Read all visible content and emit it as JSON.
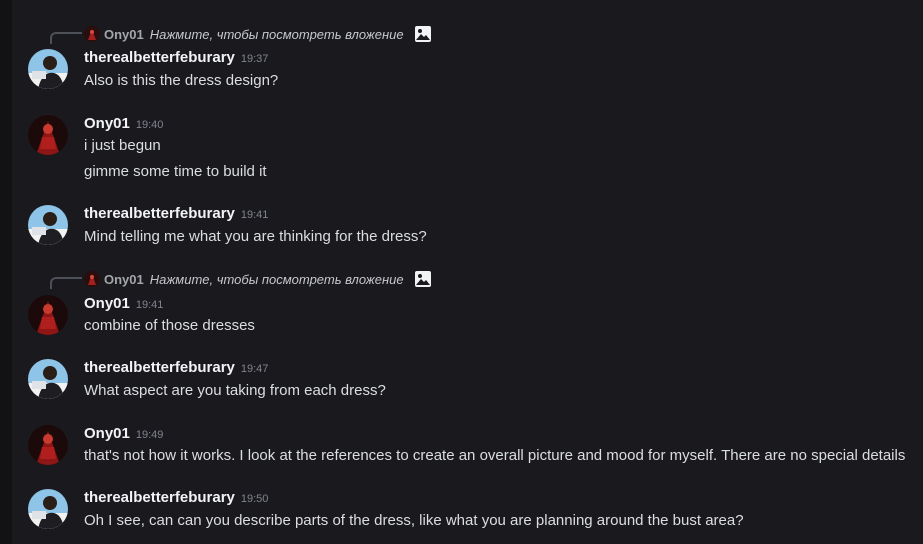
{
  "messages": [
    {
      "reply": {
        "author": "Ony01",
        "text": "Нажмите, чтобы посмотреть вложение"
      },
      "author": "therealbetterfeburary",
      "time": "19:37",
      "avatar": "blue-avatar-icon",
      "lines": [
        "Also is this the dress design?"
      ]
    },
    {
      "author": "Ony01",
      "time": "19:40",
      "avatar": "red-avatar-icon",
      "lines": [
        "i just begun",
        "gimme some time to build it"
      ]
    },
    {
      "author": "therealbetterfeburary",
      "time": "19:41",
      "avatar": "blue-avatar-icon",
      "lines": [
        "Mind telling me what you are thinking for the dress?"
      ]
    },
    {
      "reply": {
        "author": "Ony01",
        "text": "Нажмите, чтобы посмотреть вложение"
      },
      "author": "Ony01",
      "time": "19:41",
      "avatar": "red-avatar-icon",
      "lines": [
        "combine of those dresses"
      ]
    },
    {
      "author": "therealbetterfeburary",
      "time": "19:47",
      "avatar": "blue-avatar-icon",
      "lines": [
        "What aspect are you taking from each dress?"
      ]
    },
    {
      "author": "Ony01",
      "time": "19:49",
      "avatar": "red-avatar-icon",
      "lines": [
        "that's not how it works. I look at the references to create an overall picture and mood for myself. There are no special details"
      ]
    },
    {
      "author": "therealbetterfeburary",
      "time": "19:50",
      "avatar": "blue-avatar-icon",
      "lines": [
        "Oh I see, can can you describe parts of the dress, like what you are planning around the bust area?"
      ]
    }
  ],
  "colors": {
    "background": "#1a1a1e",
    "author": "#f2f3f5",
    "text": "#dbdee1",
    "timestamp": "#80848e"
  }
}
